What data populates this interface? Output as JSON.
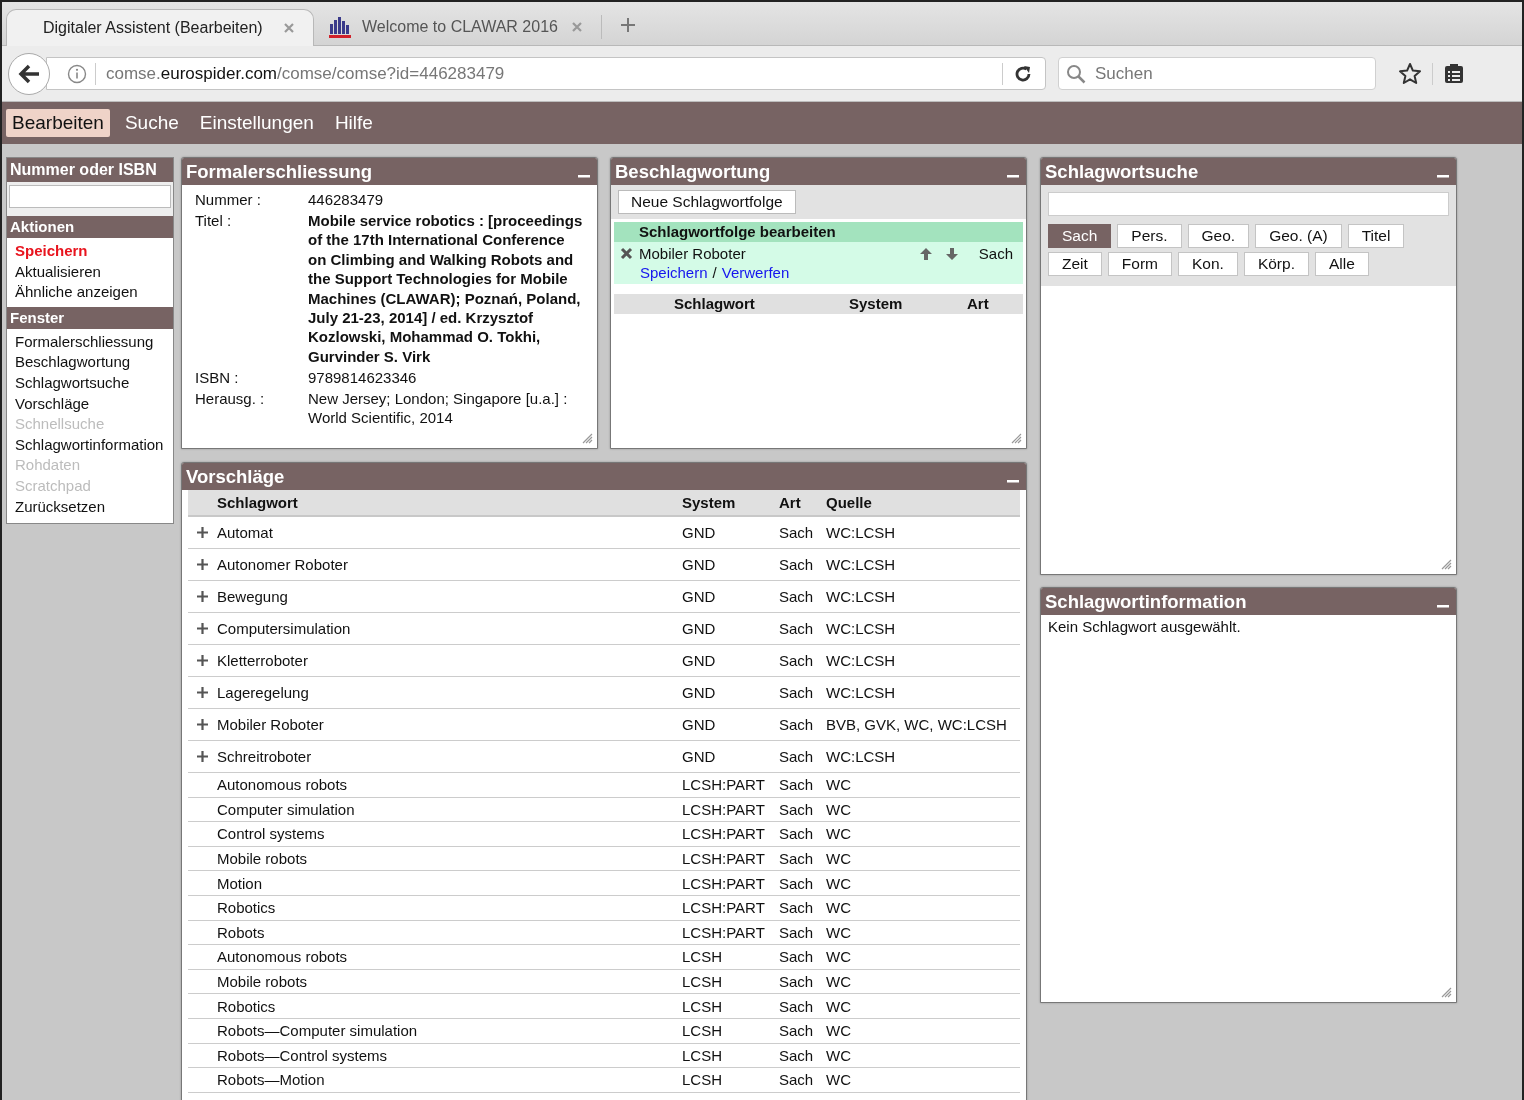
{
  "browser": {
    "tabs": [
      {
        "title": "Digitaler Assistent (Bearbeiten)",
        "selected": true,
        "favicon": false
      },
      {
        "title": "Welcome to CLAWAR 2016",
        "selected": false,
        "favicon": true
      }
    ],
    "url": {
      "prefix": "comse.",
      "domain": "eurospider.com",
      "path": "/comse/comse?id=446283479"
    },
    "search": {
      "placeholder": "Suchen"
    }
  },
  "menu": [
    {
      "label": "Bearbeiten",
      "selected": true
    },
    {
      "label": "Suche",
      "selected": false
    },
    {
      "label": "Einstellungen",
      "selected": false
    },
    {
      "label": "Hilfe",
      "selected": false
    }
  ],
  "sidebar": {
    "number_title": "Nummer oder ISBN",
    "sections": [
      {
        "title": "Aktionen",
        "items": [
          {
            "label": "Speichern",
            "emphasized": true,
            "disabled": false
          },
          {
            "label": "Aktualisieren",
            "emphasized": false,
            "disabled": false
          },
          {
            "label": "Ähnliche anzeigen",
            "emphasized": false,
            "disabled": false
          }
        ]
      },
      {
        "title": "Fenster",
        "items": [
          {
            "label": "Formalerschliessung",
            "emphasized": false,
            "disabled": false
          },
          {
            "label": "Beschlagwortung",
            "emphasized": false,
            "disabled": false
          },
          {
            "label": "Schlagwortsuche",
            "emphasized": false,
            "disabled": false
          },
          {
            "label": "Vorschläge",
            "emphasized": false,
            "disabled": false
          },
          {
            "label": "Schnellsuche",
            "emphasized": false,
            "disabled": true
          },
          {
            "label": "Schlagwortinformation",
            "emphasized": false,
            "disabled": false
          },
          {
            "label": "Rohdaten",
            "emphasized": false,
            "disabled": true
          },
          {
            "label": "Scratchpad",
            "emphasized": false,
            "disabled": true
          },
          {
            "label": "Zurücksetzen",
            "emphasized": false,
            "disabled": false
          }
        ]
      }
    ]
  },
  "formal": {
    "title": "Formalerschliessung",
    "fields": [
      {
        "label": "Nummer :",
        "value": "446283479",
        "kind": "text"
      },
      {
        "label": "Titel :",
        "value": "Mobile service robotics : [proceedings of the 17th International Conference on Climbing and Walking Robots and the Support Technologies for Mobile Machines (CLAWAR); Poznań, Poland, July 21-23, 2014] / ed. Krzysztof Kozlowski, Mohammad O. Tokhi, Gurvinder S. Virk",
        "kind": "title"
      },
      {
        "label": "ISBN :",
        "value": "9789814623346",
        "kind": "text"
      },
      {
        "label": "Herausg. :",
        "value": "New Jersey; London; Singapore [u.a.] : World Scientific, 2014",
        "kind": "text"
      }
    ]
  },
  "beschlagwortung": {
    "title": "Beschlagwortung",
    "new_button": "Neue Schlagwortfolge",
    "sequence": {
      "heading": "Schlagwortfolge bearbeiten",
      "entries": [
        {
          "term": "Mobiler Roboter",
          "art": "Sach"
        }
      ],
      "save_link": "Speichern",
      "separator": "/",
      "discard_link": "Verwerfen"
    },
    "columns": [
      "Schlagwort",
      "System",
      "Art"
    ]
  },
  "schlagwortsuche": {
    "title": "Schlagwortsuche",
    "button_rows": [
      [
        {
          "label": "Sach",
          "selected": true
        },
        {
          "label": "Pers.",
          "selected": false
        },
        {
          "label": "Geo.",
          "selected": false
        },
        {
          "label": "Geo. (A)",
          "selected": false
        },
        {
          "label": "Titel",
          "selected": false
        }
      ],
      [
        {
          "label": "Zeit",
          "selected": false
        },
        {
          "label": "Form",
          "selected": false
        },
        {
          "label": "Kon.",
          "selected": false
        },
        {
          "label": "Körp.",
          "selected": false
        },
        {
          "label": "Alle",
          "selected": false
        }
      ]
    ]
  },
  "vorschlaege": {
    "title": "Vorschläge",
    "columns": [
      "Schlagwort",
      "System",
      "Art",
      "Quelle"
    ],
    "rows": [
      {
        "term": "Automat",
        "system": "GND",
        "art": "Sach",
        "source": "WC:LCSH",
        "expandable": true
      },
      {
        "term": "Autonomer Roboter",
        "system": "GND",
        "art": "Sach",
        "source": "WC:LCSH",
        "expandable": true
      },
      {
        "term": "Bewegung",
        "system": "GND",
        "art": "Sach",
        "source": "WC:LCSH",
        "expandable": true
      },
      {
        "term": "Computersimulation",
        "system": "GND",
        "art": "Sach",
        "source": "WC:LCSH",
        "expandable": true
      },
      {
        "term": "Kletterroboter",
        "system": "GND",
        "art": "Sach",
        "source": "WC:LCSH",
        "expandable": true
      },
      {
        "term": "Lageregelung",
        "system": "GND",
        "art": "Sach",
        "source": "WC:LCSH",
        "expandable": true
      },
      {
        "term": "Mobiler Roboter",
        "system": "GND",
        "art": "Sach",
        "source": "BVB, GVK, WC, WC:LCSH",
        "expandable": true
      },
      {
        "term": "Schreitroboter",
        "system": "GND",
        "art": "Sach",
        "source": "WC:LCSH",
        "expandable": true
      },
      {
        "term": "Autonomous robots",
        "system": "LCSH:PART",
        "art": "Sach",
        "source": "WC",
        "expandable": false
      },
      {
        "term": "Computer simulation",
        "system": "LCSH:PART",
        "art": "Sach",
        "source": "WC",
        "expandable": false
      },
      {
        "term": "Control systems",
        "system": "LCSH:PART",
        "art": "Sach",
        "source": "WC",
        "expandable": false
      },
      {
        "term": "Mobile robots",
        "system": "LCSH:PART",
        "art": "Sach",
        "source": "WC",
        "expandable": false
      },
      {
        "term": "Motion",
        "system": "LCSH:PART",
        "art": "Sach",
        "source": "WC",
        "expandable": false
      },
      {
        "term": "Robotics",
        "system": "LCSH:PART",
        "art": "Sach",
        "source": "WC",
        "expandable": false
      },
      {
        "term": "Robots",
        "system": "LCSH:PART",
        "art": "Sach",
        "source": "WC",
        "expandable": false
      },
      {
        "term": "Autonomous robots",
        "system": "LCSH",
        "art": "Sach",
        "source": "WC",
        "expandable": false
      },
      {
        "term": "Mobile robots",
        "system": "LCSH",
        "art": "Sach",
        "source": "WC",
        "expandable": false
      },
      {
        "term": "Robotics",
        "system": "LCSH",
        "art": "Sach",
        "source": "WC",
        "expandable": false
      },
      {
        "term": "Robots—Computer simulation",
        "system": "LCSH",
        "art": "Sach",
        "source": "WC",
        "expandable": false
      },
      {
        "term": "Robots—Control systems",
        "system": "LCSH",
        "art": "Sach",
        "source": "WC",
        "expandable": false
      },
      {
        "term": "Robots—Motion",
        "system": "LCSH",
        "art": "Sach",
        "source": "WC",
        "expandable": false
      }
    ]
  },
  "schlagwortinformation": {
    "title": "Schlagwortinformation",
    "text": "Kein Schlagwort ausgewählt."
  }
}
